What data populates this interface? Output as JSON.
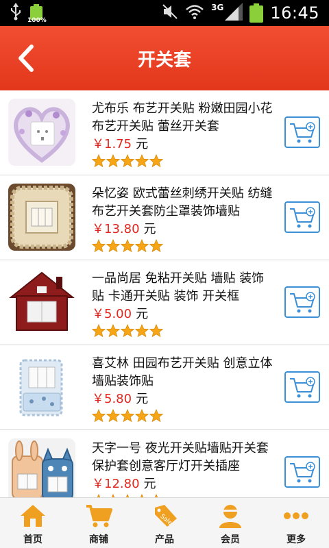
{
  "status_bar": {
    "battery_small_label": "100%",
    "network": "3G",
    "time": "16:45"
  },
  "header": {
    "title": "开关套"
  },
  "products": [
    {
      "name": "尤布乐 布艺开关贴 粉嫩田园小花布艺开关贴 蕾丝开关套",
      "price": "￥1.75",
      "unit": "元",
      "rating": 5
    },
    {
      "name": "朵忆姿 欧式蕾丝刺绣开关贴 纺缝布艺开关套防尘罩装饰墙贴",
      "price": "￥13.80",
      "unit": "元",
      "rating": 5
    },
    {
      "name": "一品尚居 免粘开关贴 墙贴 装饰贴 卡通开关贴 装饰 开关框",
      "price": "￥5.00",
      "unit": "元",
      "rating": 5
    },
    {
      "name": "喜艾林 田园布艺开关贴 创意立体墙贴装饰贴",
      "price": "￥5.80",
      "unit": "元",
      "rating": 5
    },
    {
      "name": "天字一号 夜光开关贴墙贴开关套保护套创意客厅灯开关插座",
      "price": "￥12.80",
      "unit": "元",
      "rating": 5
    }
  ],
  "bottom_nav": [
    {
      "label": "首页",
      "icon": "home-icon"
    },
    {
      "label": "商铺",
      "icon": "cart-icon"
    },
    {
      "label": "产品",
      "icon": "sale-tag-icon"
    },
    {
      "label": "会员",
      "icon": "member-icon"
    },
    {
      "label": "更多",
      "icon": "more-icon"
    }
  ],
  "colors": {
    "header": "#e83c20",
    "price": "#e0281e",
    "nav_icon": "#f0a020",
    "cart_button": "#3a8fd6"
  }
}
